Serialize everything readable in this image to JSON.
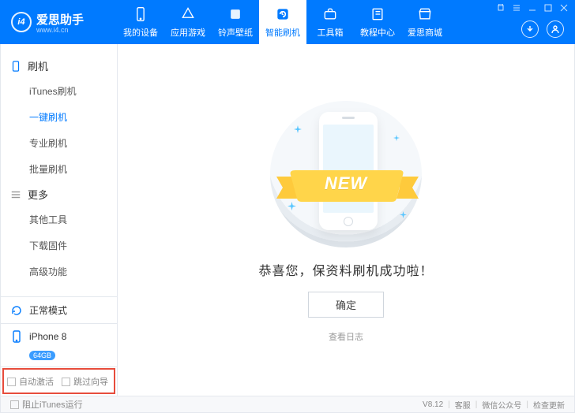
{
  "header": {
    "appName": "爱思助手",
    "url": "www.i4.cn",
    "nav": [
      {
        "label": "我的设备"
      },
      {
        "label": "应用游戏"
      },
      {
        "label": "铃声壁纸"
      },
      {
        "label": "智能刷机"
      },
      {
        "label": "工具箱"
      },
      {
        "label": "教程中心"
      },
      {
        "label": "爱思商城"
      }
    ],
    "activeNav": 3
  },
  "sidebar": {
    "group1": {
      "title": "刷机",
      "items": [
        "iTunes刷机",
        "一键刷机",
        "专业刷机",
        "批量刷机"
      ],
      "activeIndex": 1
    },
    "group2": {
      "title": "更多",
      "items": [
        "其他工具",
        "下载固件",
        "高级功能"
      ]
    },
    "mode": "正常模式",
    "device": {
      "name": "iPhone 8",
      "storage": "64GB"
    },
    "options": [
      "自动激活",
      "跳过向导"
    ]
  },
  "content": {
    "ribbon": "NEW",
    "message": "恭喜您，保资料刷机成功啦！",
    "okButton": "确定",
    "viewLog": "查看日志"
  },
  "footer": {
    "blockItunes": "阻止iTunes运行",
    "version": "V8.12",
    "service": "客服",
    "wechat": "微信公众号",
    "checkUpdate": "检查更新"
  }
}
